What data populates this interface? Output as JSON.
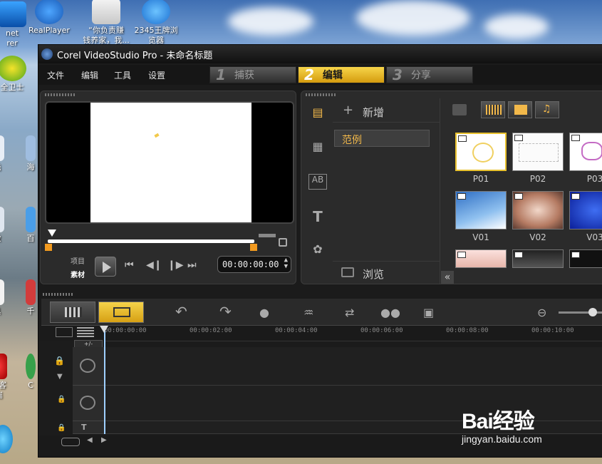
{
  "desktop": {
    "icons": [
      {
        "label": "net\nrer"
      },
      {
        "label": "RealPlayer"
      },
      {
        "label": "“你负责赚\n钱养家，我..."
      },
      {
        "label": "2345王牌浏\n览器"
      },
      {
        "label": "全卫士"
      },
      {
        "label": "浅"
      },
      {
        "label": "海"
      },
      {
        "label": "撒"
      },
      {
        "label": "百"
      },
      {
        "label": "具"
      },
      {
        "label": "千"
      },
      {
        "label": "号客\n端"
      },
      {
        "label": "C"
      }
    ]
  },
  "window": {
    "title": "Corel VideoStudio Pro - 未命名标题",
    "menu": [
      "文件",
      "编辑",
      "工具",
      "设置"
    ],
    "steps": [
      {
        "num": "1",
        "label": "捕获"
      },
      {
        "num": "2",
        "label": "编辑"
      },
      {
        "num": "3",
        "label": "分享"
      }
    ]
  },
  "preview": {
    "mode_project": "项目",
    "mode_clip": "素材",
    "timecode": "00:00:00:00"
  },
  "library": {
    "add_label": "新增",
    "folder_item": "范例",
    "browse_label": "浏览",
    "thumbs": [
      {
        "label": "P01"
      },
      {
        "label": "P02"
      },
      {
        "label": "P03"
      },
      {
        "label": "V01"
      },
      {
        "label": "V02"
      },
      {
        "label": "V03"
      }
    ]
  },
  "timeline": {
    "ticks": [
      "00:00:00:00",
      "00:00:02:00",
      "00:00:04:00",
      "00:00:06:00",
      "00:00:08:00",
      "00:00:10:00"
    ],
    "plusminus": "+/-"
  },
  "watermark": {
    "brand": "Bai经验",
    "url": "jingyan.baidu.com"
  }
}
